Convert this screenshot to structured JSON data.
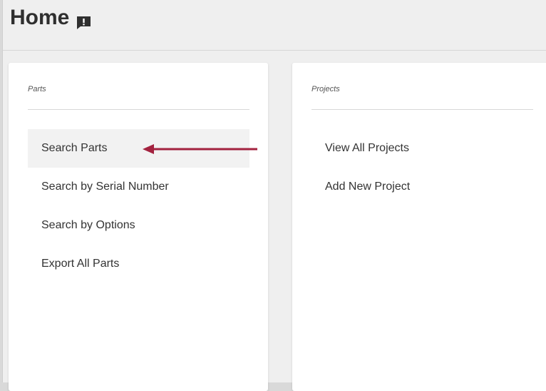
{
  "header": {
    "title": "Home",
    "title_icon": "feedback-icon"
  },
  "parts_card": {
    "title": "Parts",
    "items": [
      {
        "label": "Search Parts",
        "active": true
      },
      {
        "label": "Search by Serial Number"
      },
      {
        "label": "Search by Options"
      },
      {
        "label": "Export All Parts"
      }
    ]
  },
  "projects_card": {
    "title": "Projects",
    "items": [
      {
        "label": "View All Projects"
      },
      {
        "label": "Add New Project"
      }
    ]
  },
  "annotation": {
    "arrow_color": "#a3223f",
    "arrow_icon": "arrow-left-icon"
  }
}
